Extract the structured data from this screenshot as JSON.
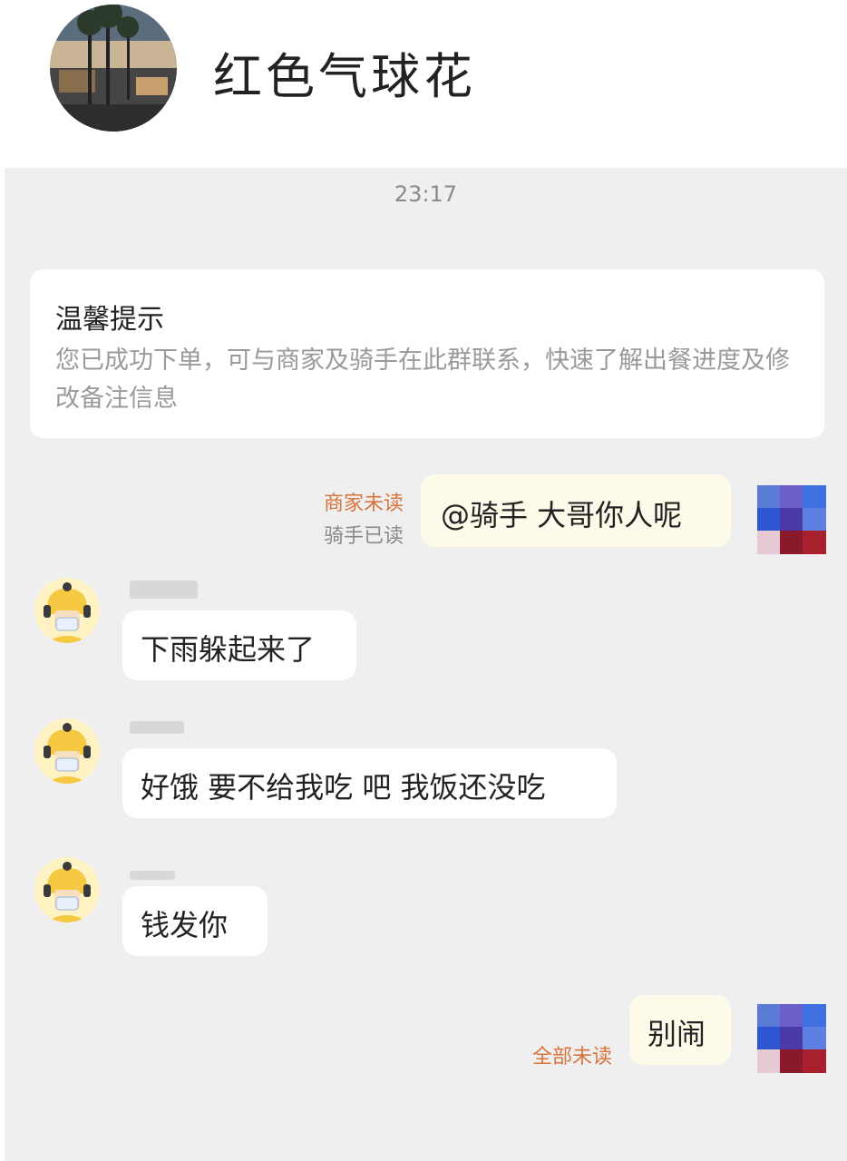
{
  "header": {
    "title": "红色气球花"
  },
  "chat": {
    "timestamp": "23:17",
    "notice": {
      "title": "温馨提示",
      "body": "您已成功下单，可与商家及骑手在此群联系，快速了解出餐进度及修改备注信息"
    },
    "messages": [
      {
        "sender": "self",
        "text": "@骑手 大哥你人呢",
        "status_lines": [
          "商家未读",
          "骑手已读"
        ]
      },
      {
        "sender": "rider",
        "text": "下雨躲起来了"
      },
      {
        "sender": "rider",
        "text": "好饿 要不给我吃 吧 我饭还没吃"
      },
      {
        "sender": "rider",
        "text": "钱发你"
      },
      {
        "sender": "self",
        "text": "别闹",
        "status_lines": [
          "全部未读"
        ]
      }
    ]
  },
  "colors": {
    "status_unread": "#d9743c",
    "status_read": "#8a8a8a",
    "chat_background": "#efefef",
    "self_bubble": "#fefaea"
  },
  "icons": {
    "rider_avatar": "rider-helmet-avatar-icon",
    "self_avatar": "pixelated-avatar-icon",
    "header_avatar": "palm-street-avatar-icon"
  }
}
